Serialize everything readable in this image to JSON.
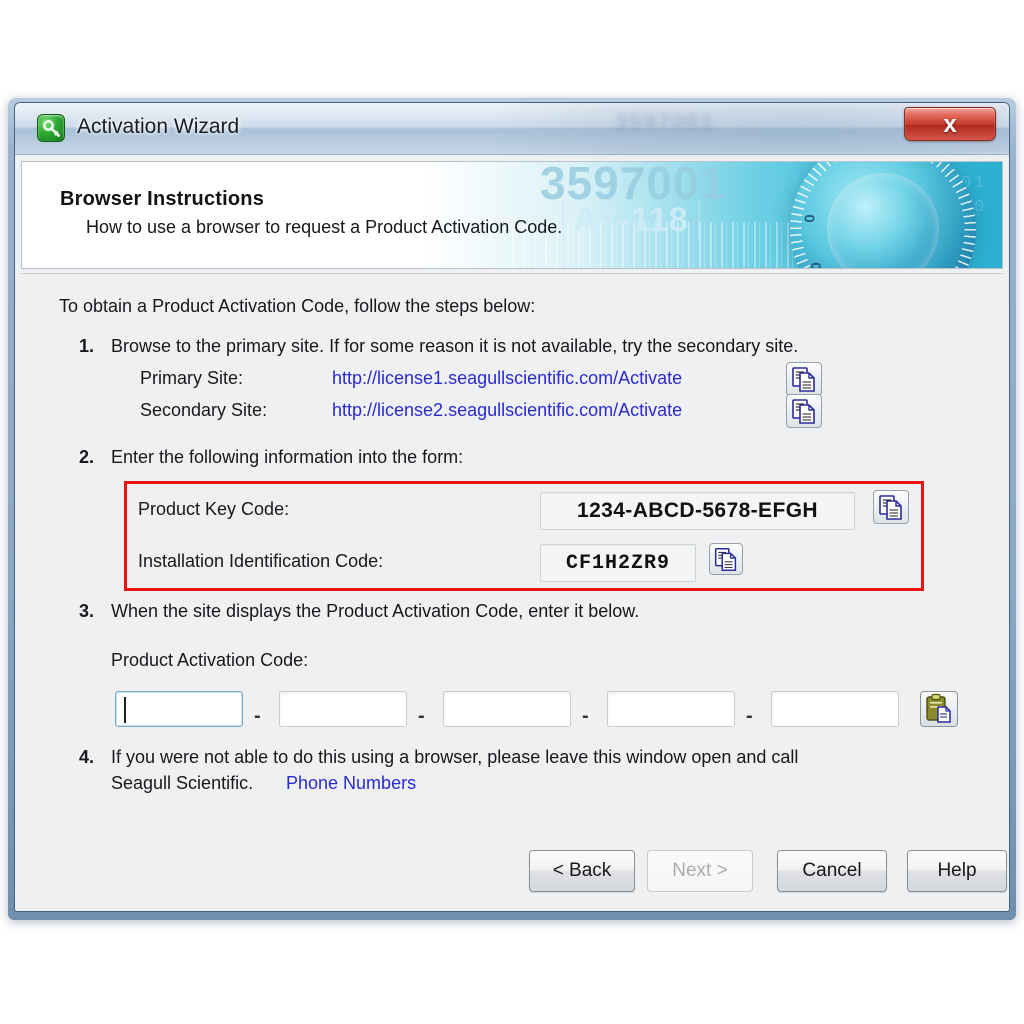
{
  "window": {
    "title": "Activation Wizard",
    "icon": "key-icon",
    "close_label": "x",
    "frame_color": "#6f8fae"
  },
  "banner": {
    "title": "Browser Instructions",
    "subtitle": "How to use a browser to request a Product Activation Code.",
    "art_digits": "3597001",
    "art_code": "A7-118",
    "art_binary": "0101101 1001 1010 0110 0101 1010110 10101",
    "accent_color": "#2fb0cf"
  },
  "body": {
    "intro": "To obtain a Product Activation Code, follow the steps below:",
    "steps": [
      {
        "num": "1.",
        "text": "Browse to the primary site. If for some reason it is not available, try the secondary site."
      },
      {
        "num": "2.",
        "text": "Enter the following information into the form:"
      },
      {
        "num": "3.",
        "text": "When the site displays the Product Activation Code, enter it below."
      },
      {
        "num": "4.",
        "text": "If you were not able to do this using a browser, please leave this window open and call",
        "text2": "Seagull Scientific."
      }
    ],
    "sites": [
      {
        "label": "Primary Site:",
        "url": "http://license1.seagullscientific.com/Activate",
        "copy_icon": "copy-icon"
      },
      {
        "label": "Secondary Site:",
        "url": "http://license2.seagullscientific.com/Activate",
        "copy_icon": "copy-icon"
      }
    ],
    "codes": [
      {
        "label": "Product Key Code:",
        "value": "1234-ABCD-5678-EFGH",
        "copy_icon": "copy-icon"
      },
      {
        "label": "Installation Identification Code:",
        "value": "CF1H2ZR9",
        "copy_icon": "copy-icon"
      }
    ],
    "highlight_color": "#ee1111",
    "activation": {
      "label": "Product Activation Code:",
      "separator": "-",
      "segments": [
        "",
        "",
        "",
        "",
        ""
      ],
      "focused_index": 0,
      "paste_icon": "paste-clipboard-icon"
    },
    "phone_link": "Phone Numbers",
    "link_color": "#2a2ad0"
  },
  "footer": {
    "buttons": [
      {
        "label": "< Back",
        "enabled": true
      },
      {
        "label": "Next  >",
        "enabled": false
      },
      {
        "label": "Cancel",
        "enabled": true
      },
      {
        "label": "Help",
        "enabled": true
      }
    ]
  }
}
